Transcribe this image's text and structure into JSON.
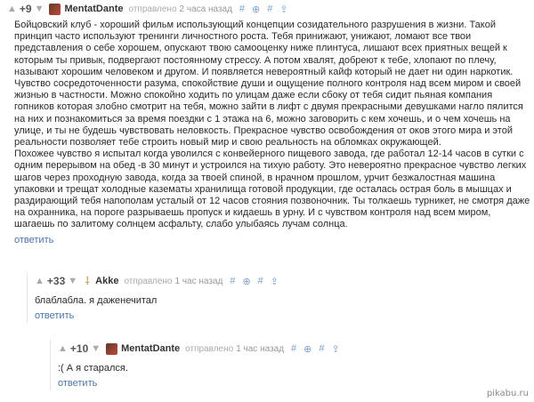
{
  "comment1": {
    "rating": "+9",
    "vote_up": "▲",
    "vote_down": "▼",
    "author": "MentatDante",
    "sent": "отправлено",
    "time": "2 часа назад",
    "actions": [
      "#",
      "⊕",
      "#",
      "⇪"
    ],
    "paragraph1": "Бойцовский клуб - хороший фильм использующий концепции созидательного разрушения в жизни. Такой принцип часто используют тренинги личностного роста. Тебя принижают, унижают, ломают все твои представления о себе хорошем, опускают твою самооценку ниже плинтуса, лишают всех приятных вещей к которым ты привык, подвергают постоянному стрессу. А потом хвалят, добреют к тебе, хлопают по плечу, называют хорошим человеком и другом. И появляется невероятный кайф который не дает ни один наркотик. Чувство сосредоточенности разума, спокойствие души и ощущение полного контроля над всем миром и своей жизнью в частности. Можно спокойно ходить по улицам даже если сбоку от тебя сидит пьяная компания гопников которая злобно смотрит на тебя, можно зайти в лифт с двумя прекрасными девушками нагло пялится на них и познакомиться за время поездки с 1 этажа на 6, можно заговорить с кем хочешь, и о чем хочешь на улице, и ты не будешь чувствовать неловкость. Прекрасное чувство освобождения от оков этого мира и этой реальности позволяет тебе строить новый мир и свою реальность на обломках окружающей.",
    "paragraph2": "Похожее чувство я испытал когда уволился с конвейерного пищевого завода, где работал 12-14 часов в сутки с одним перерывом на обед -в 30 минут и устроился на тихую работу. Это невероятно прекрасное чувство легких шагов через проходную завода, когда за твоей спиной, в нрачном прошлом, урчит безжалостная машина упаковки и трещат холодные казематы хранилища готовой продукции, где осталась острая боль в мышцах и раздирающий тебя напополам усталый от 12 часов стояния позвоночник. Ты толкаешь турникет, не смотря даже на охранника, на пороге разрываешь пропуск и кидаешь в урну. И с чувством контроля над всем миром, шагаешь по залитому солнцем асфальту, слабо улыбаясь лучам солнца.",
    "reply": "ответить"
  },
  "comment2": {
    "rating": "+33",
    "vote_up": "▲",
    "vote_down": "▼",
    "author": "Akke",
    "sent": "отправлено",
    "time": "1 час назад",
    "actions": [
      "#",
      "⊕",
      "#",
      "⇪"
    ],
    "text": "блаблабла. я даженечитал",
    "reply": "ответить"
  },
  "comment3": {
    "rating": "+10",
    "vote_up": "▲",
    "vote_down": "▼",
    "author": "MentatDante",
    "sent": "отправлено",
    "time": "1 час назад",
    "actions": [
      "#",
      "⊕",
      "#",
      "⇪"
    ],
    "text": ":( А я старался.",
    "reply": "ответить"
  },
  "watermark": "pikabu.ru"
}
